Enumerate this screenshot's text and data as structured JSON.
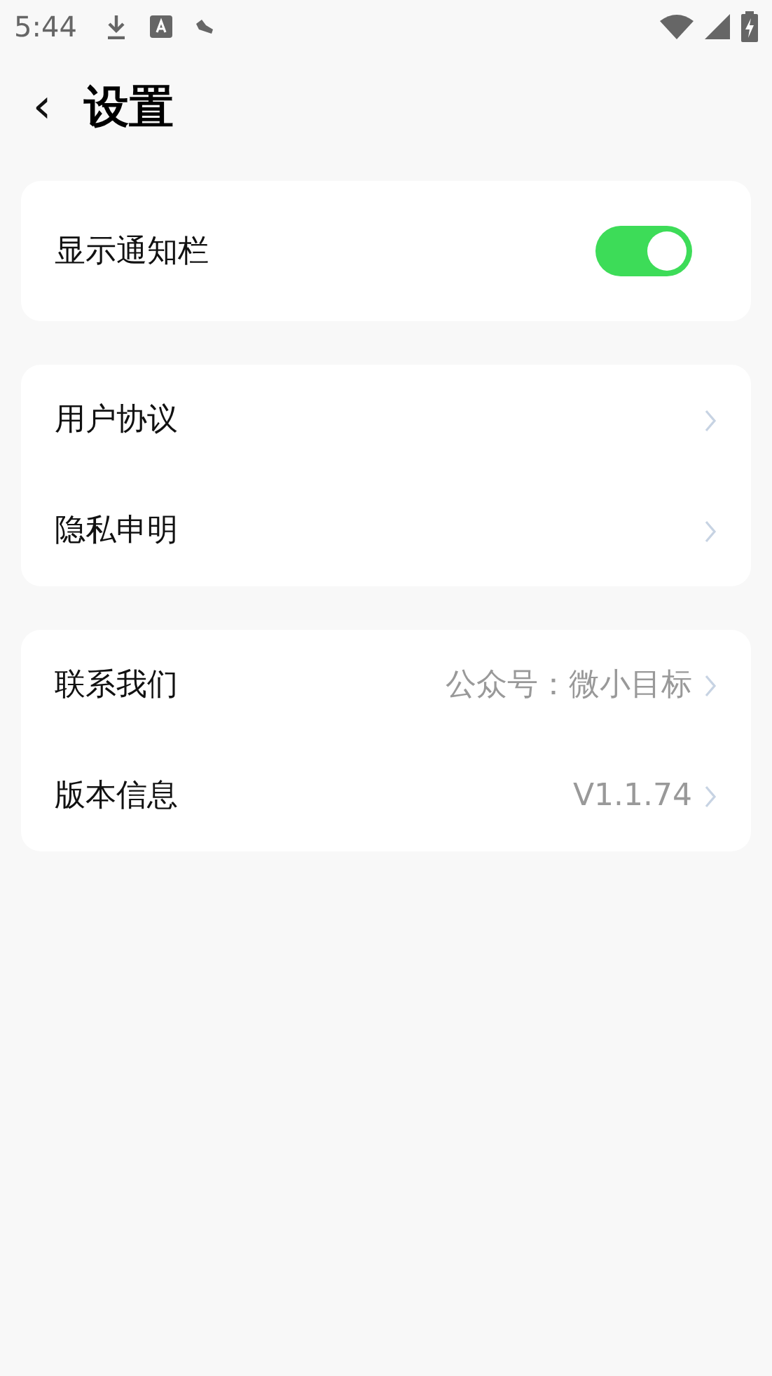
{
  "status_bar": {
    "time": "5:44"
  },
  "header": {
    "back": "‹",
    "title": "设置"
  },
  "groups": [
    {
      "items": [
        {
          "kind": "toggle",
          "label": "显示通知栏",
          "on": true
        }
      ]
    },
    {
      "items": [
        {
          "kind": "link",
          "label": "用户协议"
        },
        {
          "kind": "link",
          "label": "隐私申明"
        }
      ]
    },
    {
      "items": [
        {
          "kind": "link",
          "label": "联系我们",
          "value": "公众号：微小目标"
        },
        {
          "kind": "link",
          "label": "版本信息",
          "value": "V1.1.74"
        }
      ]
    }
  ]
}
